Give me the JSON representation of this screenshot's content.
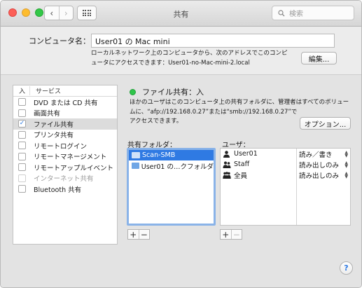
{
  "window": {
    "title": "共有",
    "search_placeholder": "検索"
  },
  "computer": {
    "label": "コンピュータ名：",
    "name": "User01 の Mac mini",
    "description_line1": "ローカルネットワーク上のコンピュータから、次のアドレスでこのコンピ",
    "description_line2": "ュータにアクセスできます：User01-no-Mac-mini-2.local",
    "edit_label": "編集..."
  },
  "services": {
    "header_on": "入",
    "header_service": "サービス",
    "items": [
      {
        "label": "DVD または CD 共有",
        "checked": false,
        "disabled": false
      },
      {
        "label": "画面共有",
        "checked": false,
        "disabled": false
      },
      {
        "label": "ファイル共有",
        "checked": true,
        "disabled": false
      },
      {
        "label": "プリンタ共有",
        "checked": false,
        "disabled": false
      },
      {
        "label": "リモートログイン",
        "checked": false,
        "disabled": false
      },
      {
        "label": "リモートマネージメント",
        "checked": false,
        "disabled": false
      },
      {
        "label": "リモートアップルイベント",
        "checked": false,
        "disabled": false
      },
      {
        "label": "インターネット共有",
        "checked": false,
        "disabled": true
      },
      {
        "label": "Bluetooth 共有",
        "checked": false,
        "disabled": false
      }
    ]
  },
  "file_sharing": {
    "status": "ファイル共有：入",
    "status_color": "#2fc54a",
    "description_line1": "ほかのユーザはこのコンピュータ上の共有フォルダに、管理者はすべてのボリュー",
    "description_line2": "ムに、“afp://192.168.0.27”または“smb://192.168.0.27”で",
    "description_line3": "アクセスできます。",
    "options_label": "オプション..."
  },
  "shared_folders": {
    "label": "共有フォルダ：",
    "items": [
      {
        "name": "Scan-SMB",
        "selected": true
      },
      {
        "name": "User01 の…クフォルダ",
        "selected": false
      }
    ],
    "add_label": "+",
    "remove_label": "−"
  },
  "users": {
    "label": "ユーザ：",
    "items": [
      {
        "name": "User01",
        "icon": "person-icon",
        "permission": "読み／書き"
      },
      {
        "name": "Staff",
        "icon": "group-icon",
        "permission": "読み出しのみ"
      },
      {
        "name": "全員",
        "icon": "everyone-icon",
        "permission": "読み出しのみ"
      }
    ],
    "add_label": "+",
    "remove_label": "−"
  },
  "help_label": "?"
}
